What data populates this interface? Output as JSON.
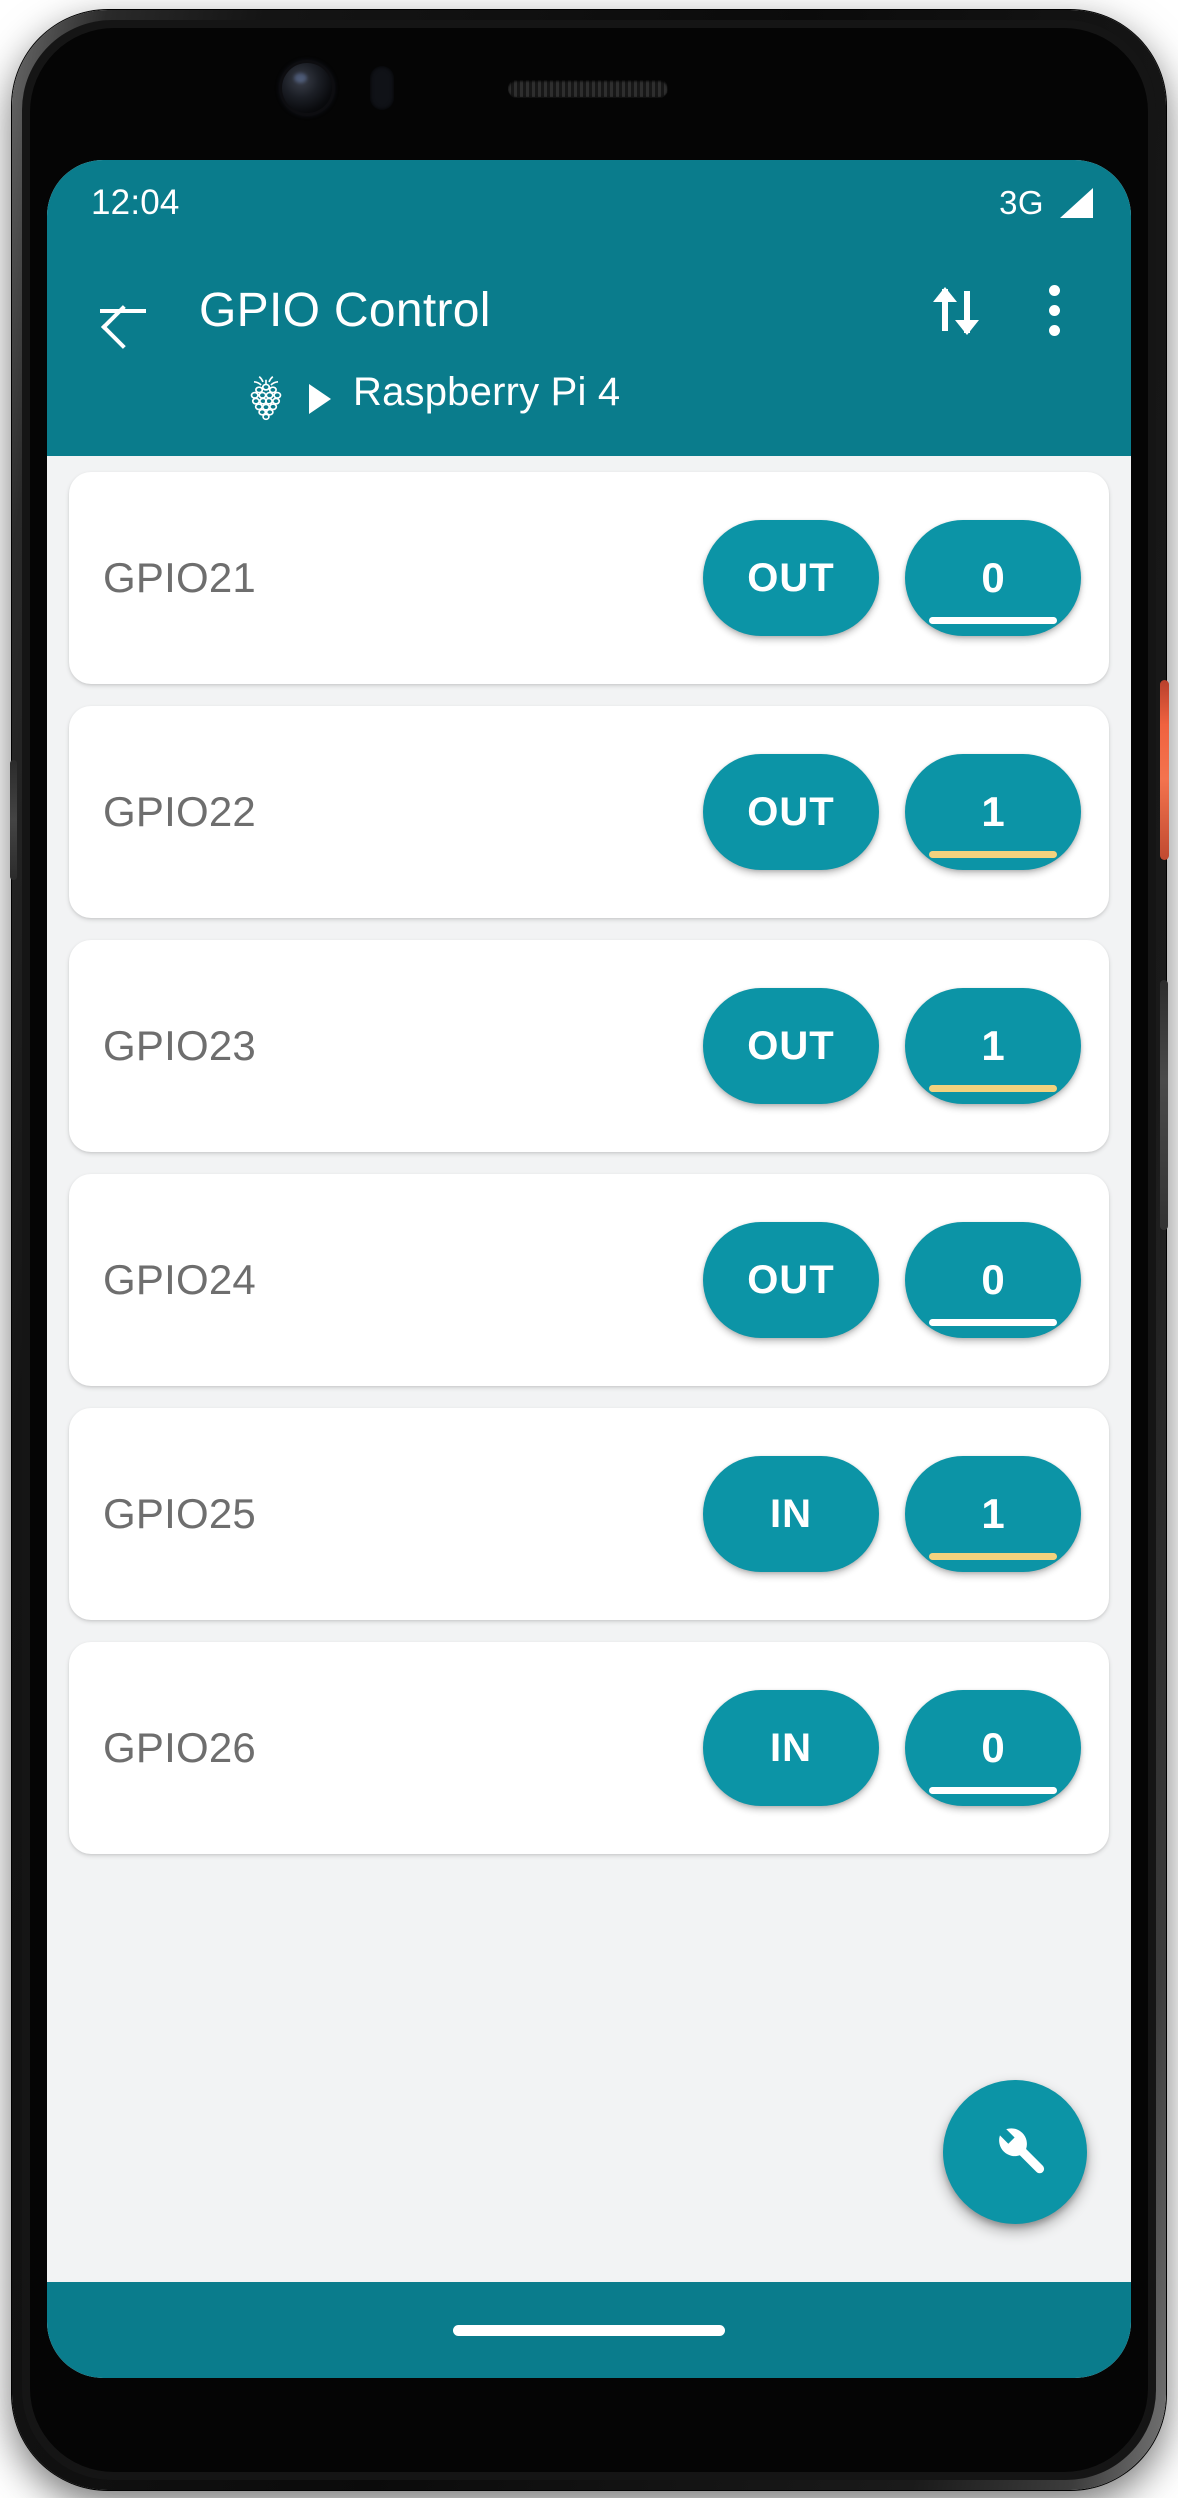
{
  "status_bar": {
    "time": "12:04",
    "network": "3G",
    "signal_icon": "signal-triangle-icon"
  },
  "app_bar": {
    "back_icon": "back-arrow-icon",
    "title": "GPIO Control",
    "transfer_icon": "up-down-arrows-icon",
    "overflow_icon": "overflow-menu-icon"
  },
  "breadcrumb": {
    "device_icon": "raspberry-pi-logo-icon",
    "separator_icon": "triangle-right-icon",
    "device_name": "Raspberry Pi 4"
  },
  "colors": {
    "teal_bar": "#0a7c8c",
    "teal_button": "#0c94a6",
    "page_background": "#f2f3f4",
    "card_background": "#ffffff",
    "label_text": "#6e6e6e",
    "state_high_underline": "#f2d27e",
    "state_low_underline": "#ffffff"
  },
  "gpio_rows": [
    {
      "name": "GPIO21",
      "direction": "OUT",
      "value": "0"
    },
    {
      "name": "GPIO22",
      "direction": "OUT",
      "value": "1"
    },
    {
      "name": "GPIO23",
      "direction": "OUT",
      "value": "1"
    },
    {
      "name": "GPIO24",
      "direction": "OUT",
      "value": "0"
    },
    {
      "name": "GPIO25",
      "direction": "IN",
      "value": "1"
    },
    {
      "name": "GPIO26",
      "direction": "IN",
      "value": "0"
    }
  ],
  "fab": {
    "icon": "wrench-icon"
  },
  "nav_bar": {
    "gesture_handle": "home-gesture-pill"
  }
}
